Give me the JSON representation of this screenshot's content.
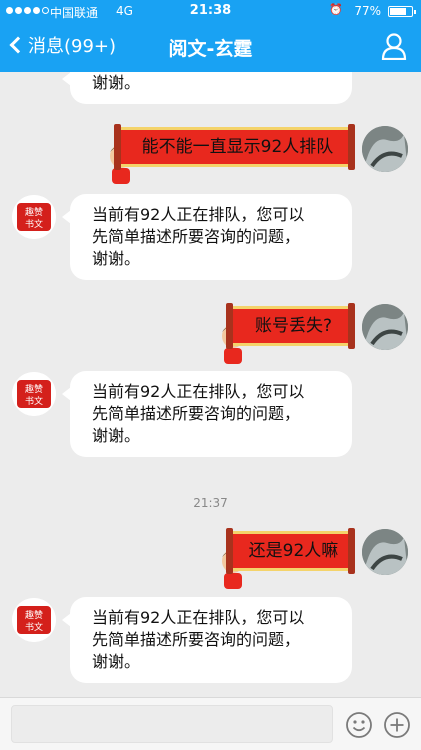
{
  "status_bar": {
    "carrier": "中国联通",
    "network": "4G",
    "time": "21:38",
    "battery": "77%",
    "battery_level": 0.77
  },
  "nav": {
    "back_label": "消息(99+)",
    "title": "阅文-玄霆"
  },
  "messages": {
    "m0_tail": "谢谢。",
    "m1": "能不能一直显示92人排队",
    "m2_l1": "当前有92人正在排队，您可以",
    "m2_l2": "先简单描述所要咨询的问题，",
    "m2_l3": "谢谢。",
    "m3": "账号丢失?",
    "m4_l1": "当前有92人正在排队，您可以",
    "m4_l2": "先简单描述所要咨询的问题，",
    "m4_l3": "谢谢。",
    "time_stamp": "21:37",
    "m5": "还是92人嘛",
    "m6_l1": "当前有92人正在排队，您可以",
    "m6_l2": "先简单描述所要咨询的问题，",
    "m6_l3": "谢谢。"
  },
  "colors": {
    "header": "#19a2f3",
    "banner": "#e8281e",
    "banner_trim": "#f4d36a"
  },
  "icons": {
    "back": "chevron-left-icon",
    "profile": "person-icon",
    "emoji": "smiley-icon",
    "add": "plus-circle-icon"
  }
}
